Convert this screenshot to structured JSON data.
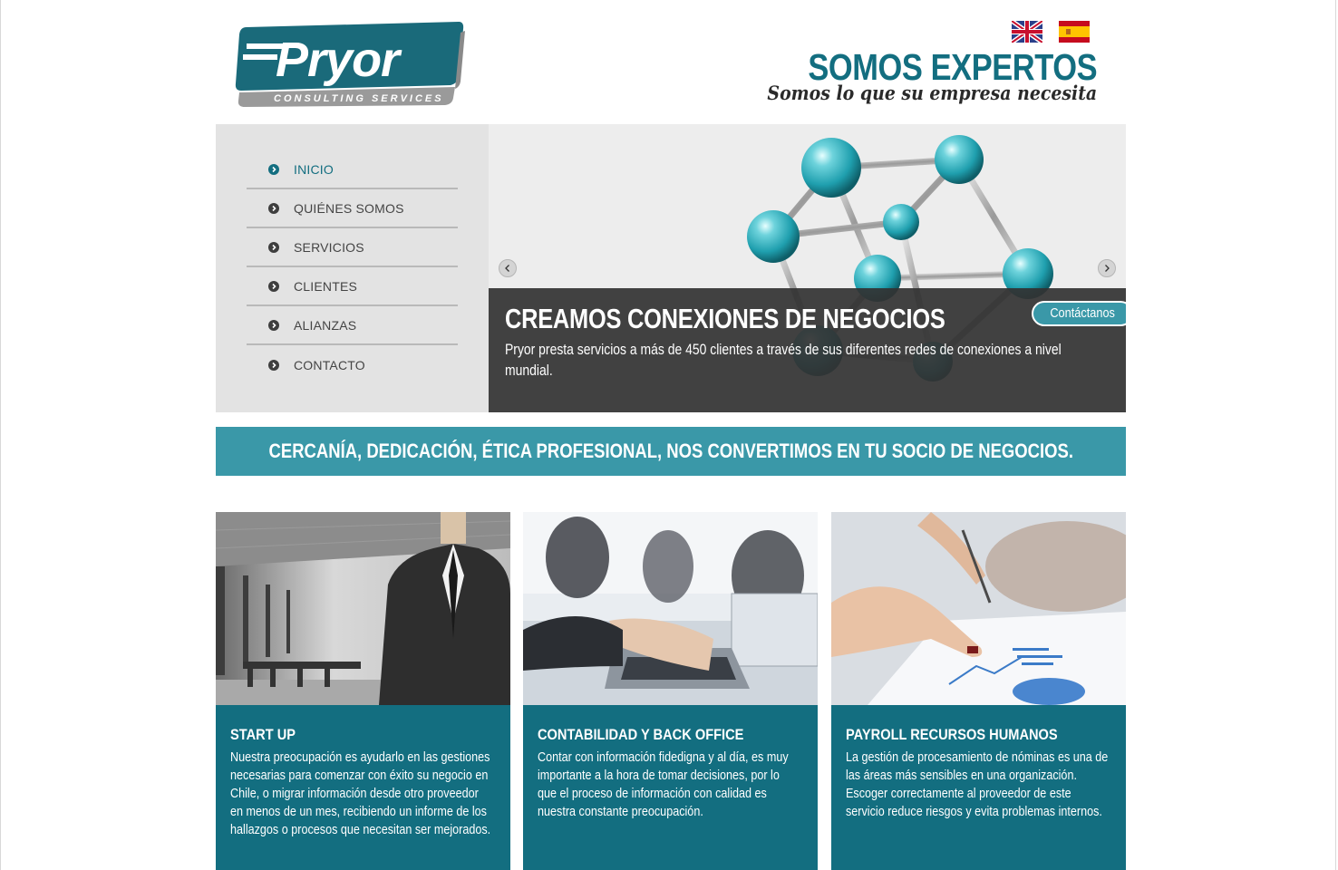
{
  "header": {
    "logo_word": "Pryor",
    "logo_sub": "CONSULTING SERVICES",
    "flags": [
      "English",
      "Español"
    ],
    "tagline_title": "SOMOS EXPERTOS",
    "tagline_sub": "Somos lo que su empresa necesita"
  },
  "nav": {
    "items": [
      {
        "label": "INICIO",
        "active": true
      },
      {
        "label": "QUIÉNES SOMOS",
        "active": false
      },
      {
        "label": "SERVICIOS",
        "active": false
      },
      {
        "label": "CLIENTES",
        "active": false
      },
      {
        "label": "ALIANZAS",
        "active": false
      },
      {
        "label": "CONTACTO",
        "active": false
      }
    ]
  },
  "slider": {
    "title": "CREAMOS CONEXIONES DE NEGOCIOS",
    "text": "Pryor presta servicios a más de 450 clientes a través de sus diferentes redes de conexiones a nivel mundial.",
    "button": "Contáctanos"
  },
  "banner": {
    "text": "CERCANÍA, DEDICACIÓN, ÉTICA PROFESIONAL, NOS CONVERTIMOS EN TU SOCIO DE NEGOCIOS."
  },
  "cards": [
    {
      "title": "START UP",
      "text": "Nuestra preocupación es ayudarlo en las gestiones necesarias para comenzar con éxito su negocio en Chile, o migrar información desde otro proveedor en menos de un mes, recibiendo un informe de los hallazgos o procesos que necesitan ser mejorados."
    },
    {
      "title": "CONTABILIDAD Y BACK OFFICE",
      "text": "Contar con información fidedigna y al día, es muy importante a la hora de tomar decisiones, por lo que el proceso de información con calidad es nuestra constante preocupación."
    },
    {
      "title": "PAYROLL RECURSOS HUMANOS",
      "text": "La gestión de procesamiento de nóminas es una de las áreas más sensibles en una organización. Escoger correctamente al proveedor de este servicio reduce riesgos y evita problemas internos."
    }
  ],
  "colors": {
    "brand_teal": "#136e80",
    "accent_teal": "#3a98a8",
    "sidebar_bg": "#e3e3e3",
    "caption_bg": "#333333"
  }
}
